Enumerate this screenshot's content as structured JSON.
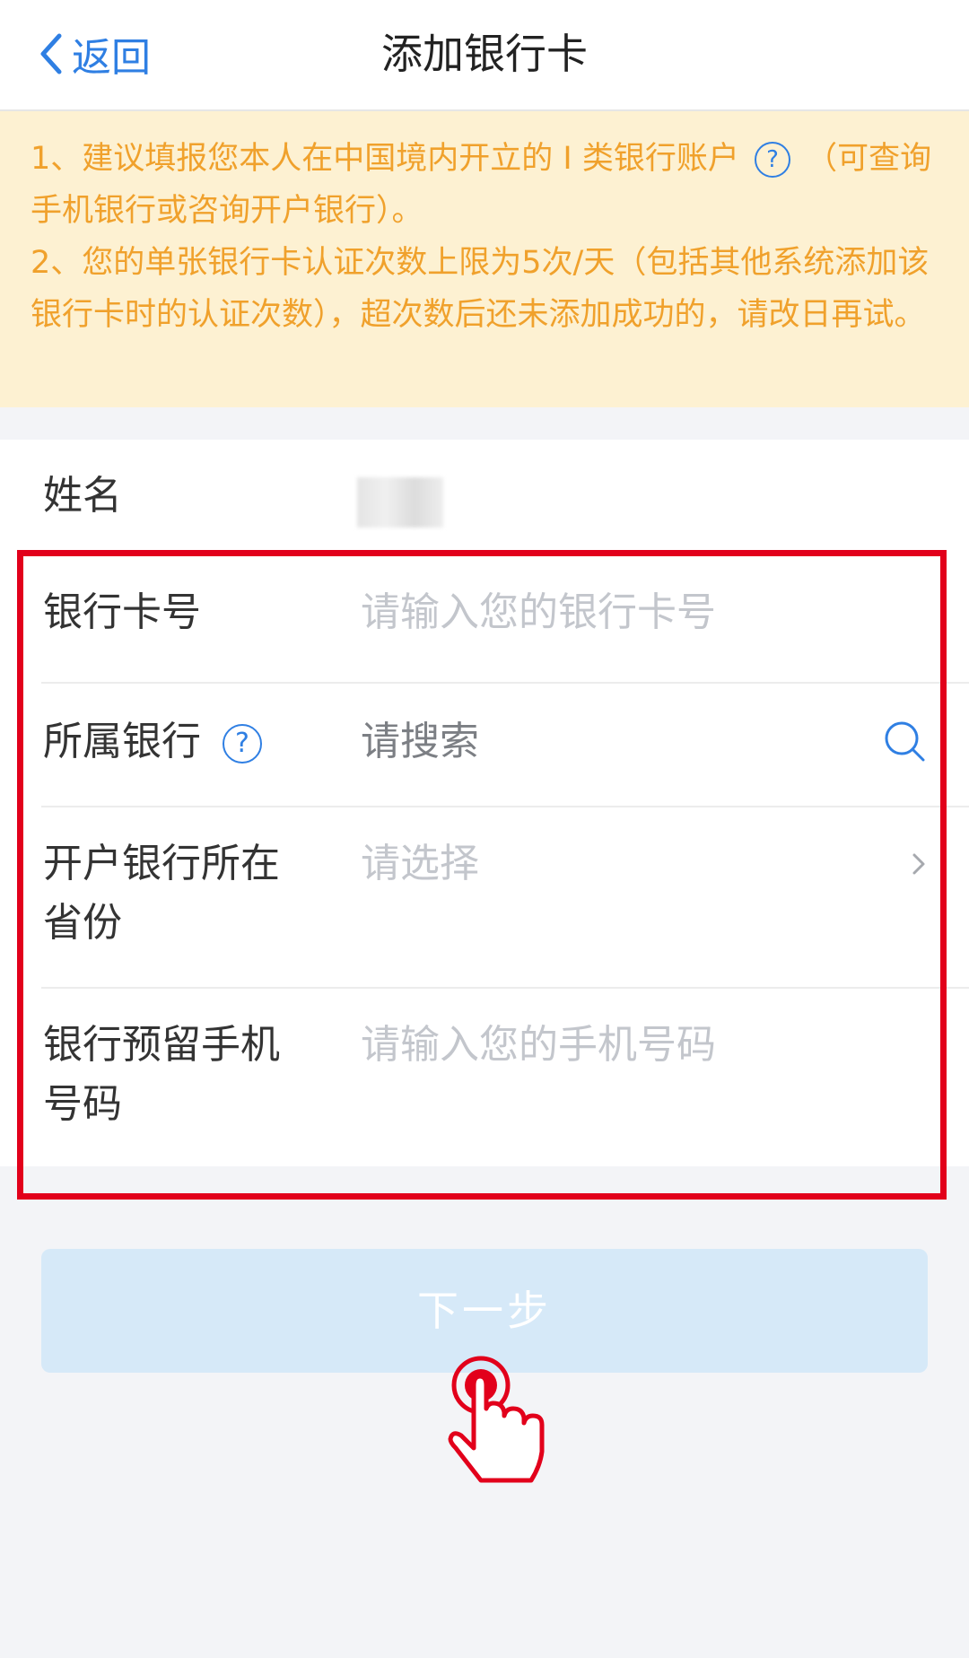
{
  "header": {
    "back_label": "返回",
    "title": "添加银行卡"
  },
  "notice": {
    "line1_before": "1、建议填报您本人在中国境内开立的 I 类银行账户",
    "line1_help": "?",
    "line1_after": "（可查询手机银行或咨询开户银行）。",
    "line2": "2、您的单张银行卡认证次数上限为5次/天（包括其他系统添加该银行卡时的认证次数），超次数后还未添加成功的，请改日再试。"
  },
  "form": {
    "name_label": "姓名",
    "card_label": "银行卡号",
    "card_placeholder": "请输入您的银行卡号",
    "bank_label": "所属银行",
    "bank_help": "?",
    "bank_placeholder": "请搜索",
    "province_label_1": "开户银行所在",
    "province_label_2": "省份",
    "province_placeholder": "请选择",
    "phone_label_1": "银行预留手机",
    "phone_label_2": "号码",
    "phone_placeholder": "请输入您的手机号码"
  },
  "actions": {
    "next_label": "下一步"
  },
  "colors": {
    "accent": "#2f7fe3",
    "notice_text": "#f0a12c",
    "notice_bg": "#fdf1d2",
    "highlight": "#e2001b",
    "button_bg": "#d6e9f8"
  },
  "icons": [
    "chevron-left-icon",
    "help-icon",
    "search-icon",
    "chevron-right-icon",
    "tap-hand-icon"
  ]
}
